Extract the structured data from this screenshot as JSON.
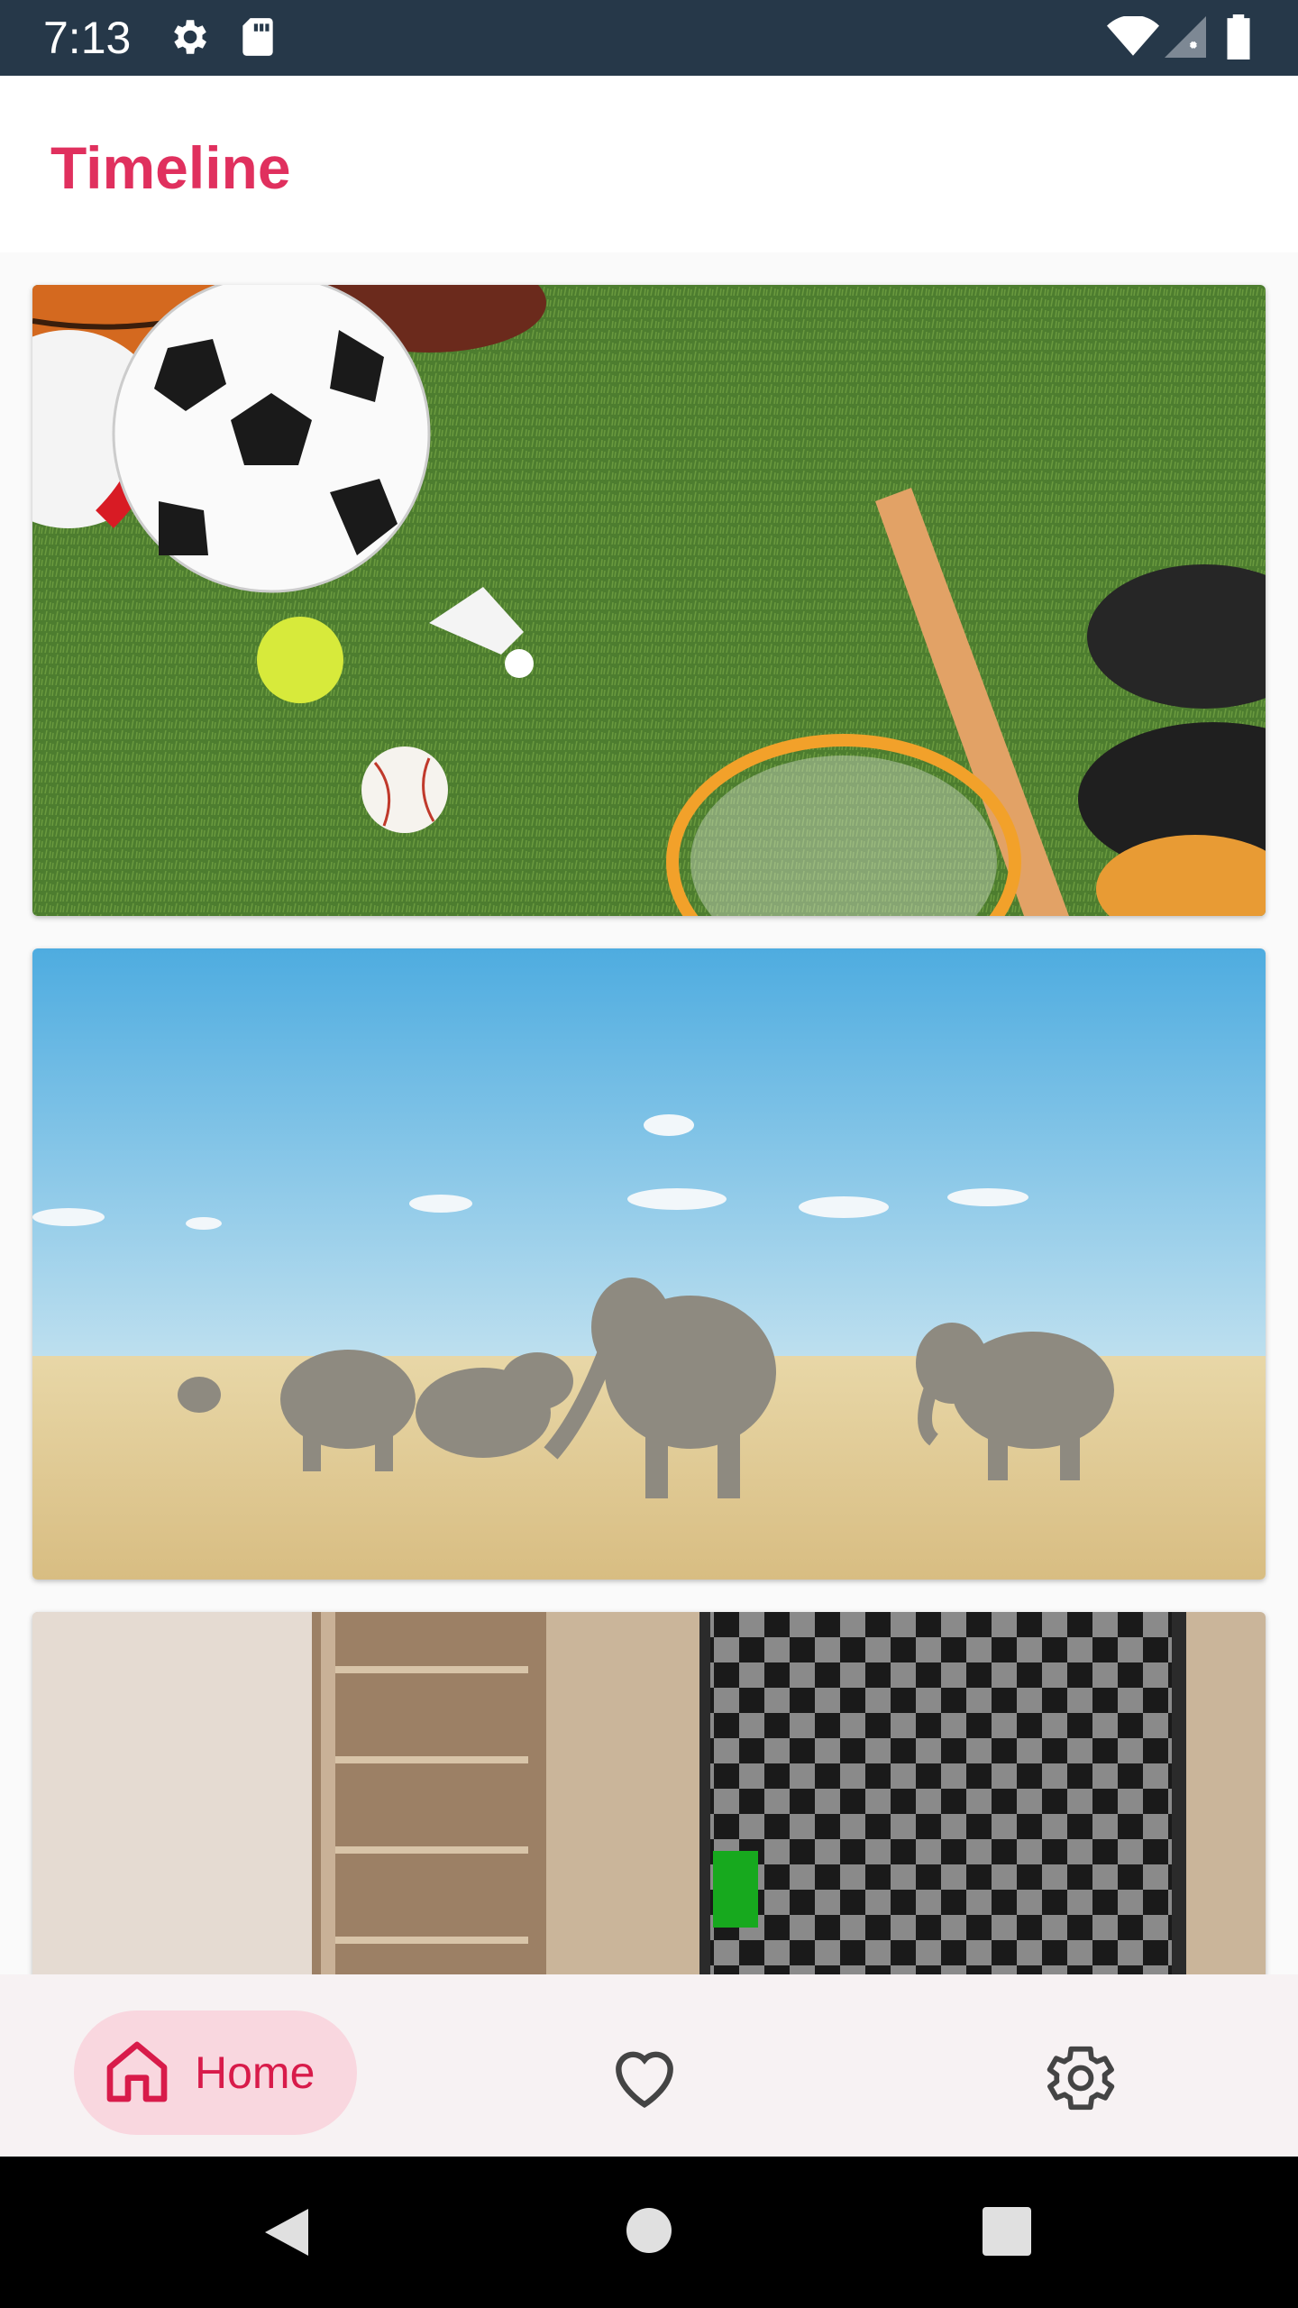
{
  "status_bar": {
    "time": "7:13",
    "icons": [
      "settings-icon",
      "sd-card-icon",
      "wifi-icon",
      "signal-icon",
      "battery-icon"
    ]
  },
  "app_bar": {
    "title": "Timeline",
    "title_color": "#e0305e"
  },
  "feed": {
    "cards": [
      {
        "image": "sports-equipment-on-grass"
      },
      {
        "image": "elephants-on-savanna"
      },
      {
        "image": "room-with-checkerboard-monitor"
      }
    ]
  },
  "bottom_nav": {
    "items": [
      {
        "label": "Home",
        "icon": "home-icon",
        "selected": true
      },
      {
        "label": "",
        "icon": "heart-icon",
        "selected": false
      },
      {
        "label": "",
        "icon": "gear-icon",
        "selected": false
      }
    ],
    "active_color": "#d81b4a",
    "pill_color": "#f9d7df"
  },
  "system_nav": {
    "buttons": [
      "back-icon",
      "home-circle-icon",
      "recents-icon"
    ]
  }
}
